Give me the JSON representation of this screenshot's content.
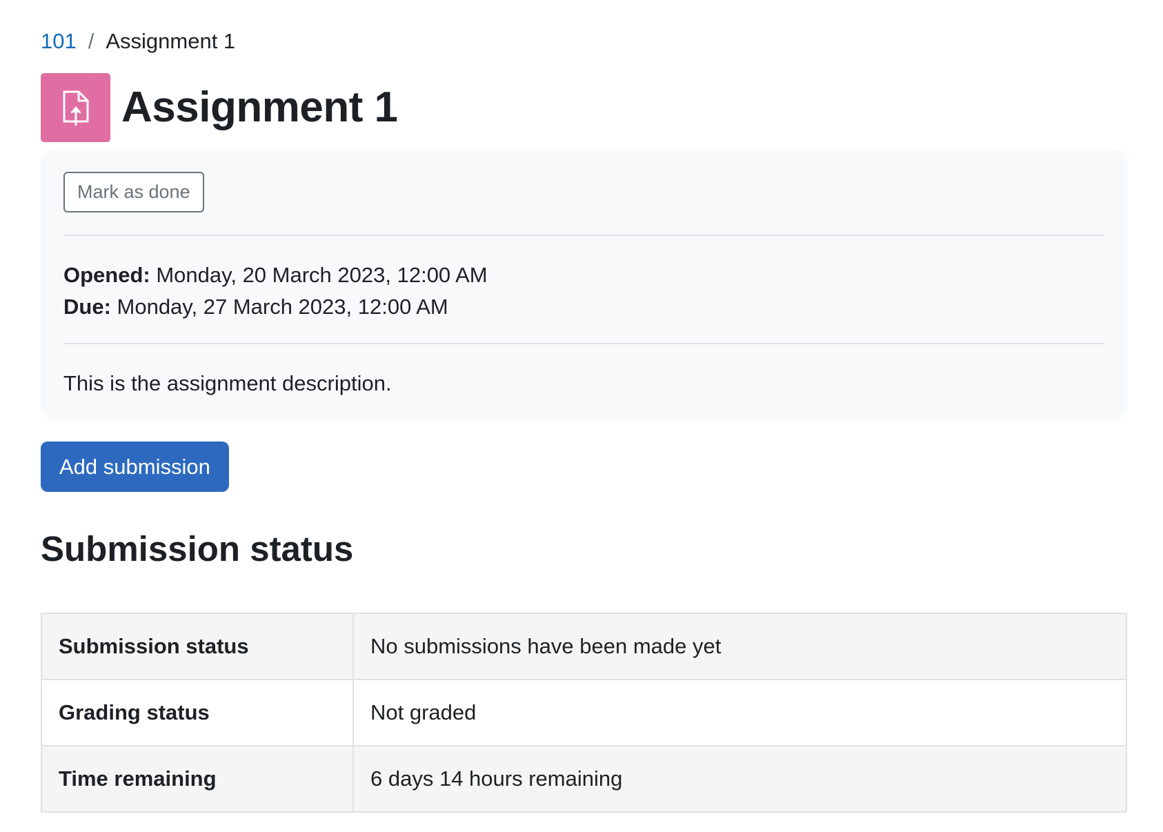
{
  "breadcrumb": {
    "course": "101",
    "separator": "/",
    "current": "Assignment 1"
  },
  "header": {
    "title": "Assignment 1",
    "icon": "file-upload-icon",
    "icon_color": "#e06ea3"
  },
  "activity_info": {
    "mark_done_label": "Mark as done",
    "opened_label": "Opened:",
    "opened_value": "Monday, 20 March 2023, 12:00 AM",
    "due_label": "Due:",
    "due_value": "Monday, 27 March 2023, 12:00 AM",
    "description": "This is the assignment description."
  },
  "actions": {
    "add_submission_label": "Add submission",
    "primary_color": "#2d6abf"
  },
  "submission_status": {
    "heading": "Submission status",
    "rows": [
      {
        "label": "Submission status",
        "value": "No submissions have been made yet"
      },
      {
        "label": "Grading status",
        "value": "Not graded"
      },
      {
        "label": "Time remaining",
        "value": "6 days 14 hours remaining"
      }
    ]
  }
}
